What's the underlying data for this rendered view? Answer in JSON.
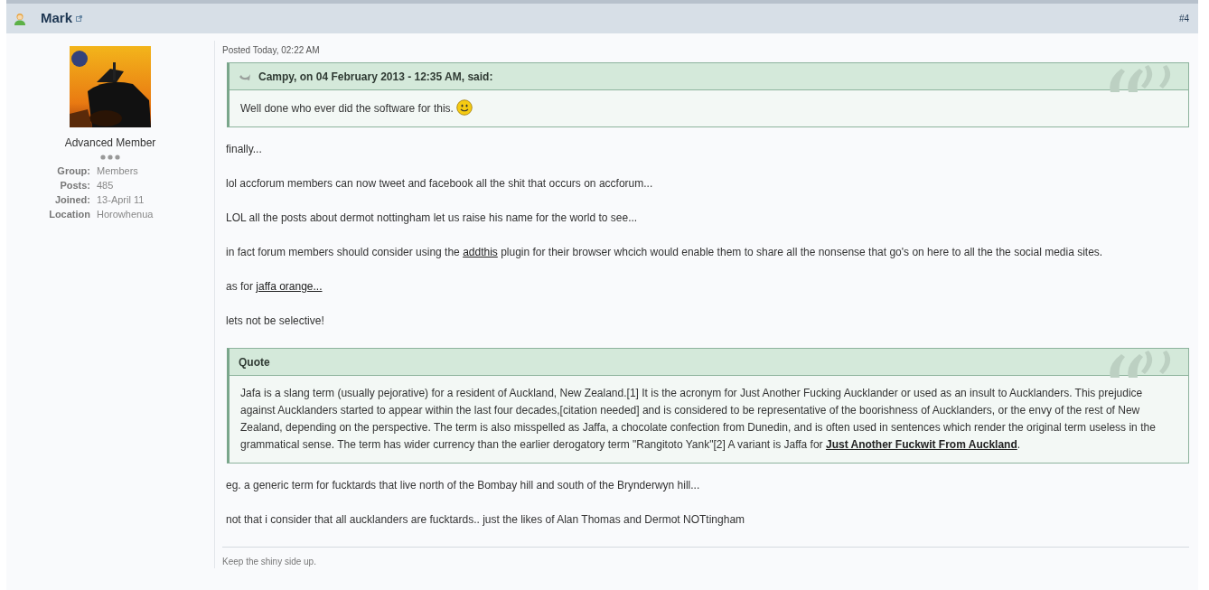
{
  "post": {
    "author": "Mark",
    "number": "#4",
    "posted": "Posted Today, 02:22 AM"
  },
  "profile": {
    "rank": "Advanced Member",
    "fields": [
      {
        "label": "Group:",
        "value": "Members"
      },
      {
        "label": "Posts:",
        "value": "485"
      },
      {
        "label": "Joined:",
        "value": "13-April 11"
      },
      {
        "label": "Location",
        "value": "Horowhenua"
      }
    ]
  },
  "body": [
    {
      "kind": "cited_quote",
      "title": "Campy, on 04 February 2013 - 12:35 AM, said:",
      "segments": [
        {
          "kind": "text",
          "text": "Well done who ever did the software for this."
        },
        {
          "kind": "smiley"
        }
      ]
    },
    {
      "kind": "paragraph",
      "segments": [
        {
          "kind": "text",
          "text": "finally..."
        }
      ]
    },
    {
      "kind": "paragraph",
      "segments": [
        {
          "kind": "text",
          "text": "lol accforum members can now tweet and facebook all the shit that occurs on accforum..."
        }
      ]
    },
    {
      "kind": "paragraph",
      "segments": [
        {
          "kind": "text",
          "text": "LOL all the posts about dermot nottingham let us raise his name for the world to see..."
        }
      ]
    },
    {
      "kind": "paragraph",
      "segments": [
        {
          "kind": "text",
          "text": "in fact forum members should consider using the "
        },
        {
          "kind": "link",
          "text": "addthis"
        },
        {
          "kind": "text",
          "text": " plugin for their browser whcich would enable them to share all the nonsense that go's on here to all the the social media sites."
        }
      ]
    },
    {
      "kind": "paragraph",
      "segments": [
        {
          "kind": "text",
          "text": "as for "
        },
        {
          "kind": "link",
          "text": "jaffa orange..."
        }
      ]
    },
    {
      "kind": "paragraph",
      "segments": [
        {
          "kind": "text",
          "text": "lets not be selective!"
        }
      ]
    },
    {
      "kind": "quote",
      "title": "Quote",
      "segments": [
        {
          "kind": "text",
          "text": "Jafa is a slang term (usually pejorative) for a resident of Auckland, New Zealand.[1] It is the acronym for Just Another Fucking Aucklander or used as an insult to Aucklanders. This prejudice against Aucklanders started to appear within the last four decades,[citation needed] and is considered to be representative of the boorishness of Aucklanders, or the envy of the rest of New Zealand, depending on the perspective. The term is also misspelled as Jaffa, a chocolate confection from Dunedin, and is often used in sentences which render the original term useless in the grammatical sense. The term has wider currency than the earlier derogatory term \"Rangitoto Yank\"[2] A variant is Jaffa for "
        },
        {
          "kind": "boldlink",
          "text": "Just Another Fuckwit From Auckland"
        },
        {
          "kind": "text",
          "text": "."
        }
      ]
    },
    {
      "kind": "paragraph",
      "segments": [
        {
          "kind": "text",
          "text": "eg. a generic term for fucktards that live north of the Bombay hill and south of the Brynderwyn hill..."
        }
      ]
    },
    {
      "kind": "paragraph",
      "segments": [
        {
          "kind": "text",
          "text": "not that i consider that all aucklanders are fucktards.. just the likes of Alan Thomas and Dermot NOTtingham"
        }
      ]
    }
  ],
  "signature": "Keep the shiny side up."
}
